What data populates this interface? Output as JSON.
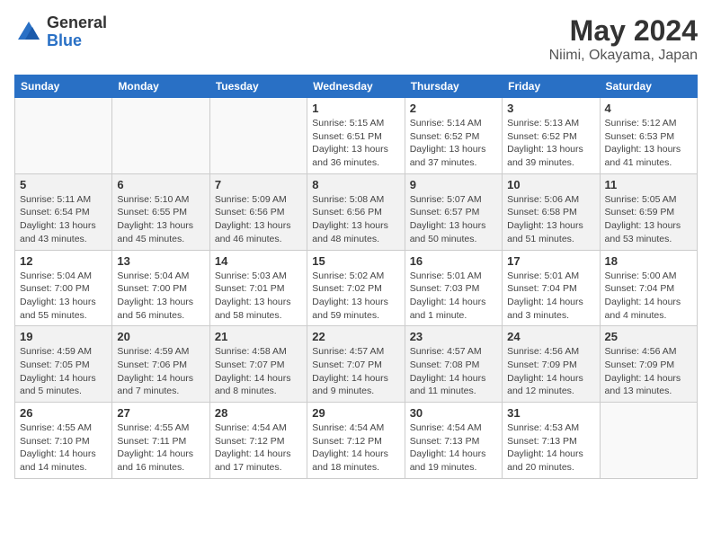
{
  "logo": {
    "general": "General",
    "blue": "Blue"
  },
  "title": "May 2024",
  "subtitle": "Niimi, Okayama, Japan",
  "days_of_week": [
    "Sunday",
    "Monday",
    "Tuesday",
    "Wednesday",
    "Thursday",
    "Friday",
    "Saturday"
  ],
  "weeks": [
    [
      {
        "day": "",
        "info": ""
      },
      {
        "day": "",
        "info": ""
      },
      {
        "day": "",
        "info": ""
      },
      {
        "day": "1",
        "info": "Sunrise: 5:15 AM\nSunset: 6:51 PM\nDaylight: 13 hours and 36 minutes."
      },
      {
        "day": "2",
        "info": "Sunrise: 5:14 AM\nSunset: 6:52 PM\nDaylight: 13 hours and 37 minutes."
      },
      {
        "day": "3",
        "info": "Sunrise: 5:13 AM\nSunset: 6:52 PM\nDaylight: 13 hours and 39 minutes."
      },
      {
        "day": "4",
        "info": "Sunrise: 5:12 AM\nSunset: 6:53 PM\nDaylight: 13 hours and 41 minutes."
      }
    ],
    [
      {
        "day": "5",
        "info": "Sunrise: 5:11 AM\nSunset: 6:54 PM\nDaylight: 13 hours and 43 minutes."
      },
      {
        "day": "6",
        "info": "Sunrise: 5:10 AM\nSunset: 6:55 PM\nDaylight: 13 hours and 45 minutes."
      },
      {
        "day": "7",
        "info": "Sunrise: 5:09 AM\nSunset: 6:56 PM\nDaylight: 13 hours and 46 minutes."
      },
      {
        "day": "8",
        "info": "Sunrise: 5:08 AM\nSunset: 6:56 PM\nDaylight: 13 hours and 48 minutes."
      },
      {
        "day": "9",
        "info": "Sunrise: 5:07 AM\nSunset: 6:57 PM\nDaylight: 13 hours and 50 minutes."
      },
      {
        "day": "10",
        "info": "Sunrise: 5:06 AM\nSunset: 6:58 PM\nDaylight: 13 hours and 51 minutes."
      },
      {
        "day": "11",
        "info": "Sunrise: 5:05 AM\nSunset: 6:59 PM\nDaylight: 13 hours and 53 minutes."
      }
    ],
    [
      {
        "day": "12",
        "info": "Sunrise: 5:04 AM\nSunset: 7:00 PM\nDaylight: 13 hours and 55 minutes."
      },
      {
        "day": "13",
        "info": "Sunrise: 5:04 AM\nSunset: 7:00 PM\nDaylight: 13 hours and 56 minutes."
      },
      {
        "day": "14",
        "info": "Sunrise: 5:03 AM\nSunset: 7:01 PM\nDaylight: 13 hours and 58 minutes."
      },
      {
        "day": "15",
        "info": "Sunrise: 5:02 AM\nSunset: 7:02 PM\nDaylight: 13 hours and 59 minutes."
      },
      {
        "day": "16",
        "info": "Sunrise: 5:01 AM\nSunset: 7:03 PM\nDaylight: 14 hours and 1 minute."
      },
      {
        "day": "17",
        "info": "Sunrise: 5:01 AM\nSunset: 7:04 PM\nDaylight: 14 hours and 3 minutes."
      },
      {
        "day": "18",
        "info": "Sunrise: 5:00 AM\nSunset: 7:04 PM\nDaylight: 14 hours and 4 minutes."
      }
    ],
    [
      {
        "day": "19",
        "info": "Sunrise: 4:59 AM\nSunset: 7:05 PM\nDaylight: 14 hours and 5 minutes."
      },
      {
        "day": "20",
        "info": "Sunrise: 4:59 AM\nSunset: 7:06 PM\nDaylight: 14 hours and 7 minutes."
      },
      {
        "day": "21",
        "info": "Sunrise: 4:58 AM\nSunset: 7:07 PM\nDaylight: 14 hours and 8 minutes."
      },
      {
        "day": "22",
        "info": "Sunrise: 4:57 AM\nSunset: 7:07 PM\nDaylight: 14 hours and 9 minutes."
      },
      {
        "day": "23",
        "info": "Sunrise: 4:57 AM\nSunset: 7:08 PM\nDaylight: 14 hours and 11 minutes."
      },
      {
        "day": "24",
        "info": "Sunrise: 4:56 AM\nSunset: 7:09 PM\nDaylight: 14 hours and 12 minutes."
      },
      {
        "day": "25",
        "info": "Sunrise: 4:56 AM\nSunset: 7:09 PM\nDaylight: 14 hours and 13 minutes."
      }
    ],
    [
      {
        "day": "26",
        "info": "Sunrise: 4:55 AM\nSunset: 7:10 PM\nDaylight: 14 hours and 14 minutes."
      },
      {
        "day": "27",
        "info": "Sunrise: 4:55 AM\nSunset: 7:11 PM\nDaylight: 14 hours and 16 minutes."
      },
      {
        "day": "28",
        "info": "Sunrise: 4:54 AM\nSunset: 7:12 PM\nDaylight: 14 hours and 17 minutes."
      },
      {
        "day": "29",
        "info": "Sunrise: 4:54 AM\nSunset: 7:12 PM\nDaylight: 14 hours and 18 minutes."
      },
      {
        "day": "30",
        "info": "Sunrise: 4:54 AM\nSunset: 7:13 PM\nDaylight: 14 hours and 19 minutes."
      },
      {
        "day": "31",
        "info": "Sunrise: 4:53 AM\nSunset: 7:13 PM\nDaylight: 14 hours and 20 minutes."
      },
      {
        "day": "",
        "info": ""
      }
    ]
  ]
}
